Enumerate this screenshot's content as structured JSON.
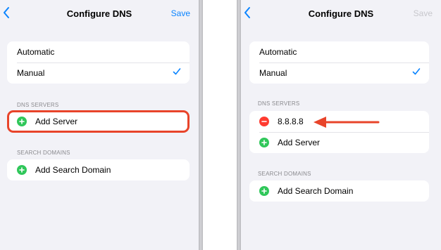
{
  "left_screen": {
    "nav": {
      "back_icon": "chevron-left-icon",
      "title": "Configure DNS",
      "save_label": "Save"
    },
    "mode_options": [
      {
        "label": "Automatic",
        "selected": false
      },
      {
        "label": "Manual",
        "selected": true
      }
    ],
    "dns_servers": {
      "header": "DNS SERVERS",
      "servers": [],
      "add_label": "Add Server"
    },
    "search_domains": {
      "header": "SEARCH DOMAINS",
      "add_label": "Add Search Domain"
    }
  },
  "right_screen": {
    "nav": {
      "back_icon": "chevron-left-icon",
      "title": "Configure DNS",
      "save_label": "Save",
      "save_enabled": false
    },
    "mode_options": [
      {
        "label": "Automatic",
        "selected": false
      },
      {
        "label": "Manual",
        "selected": true
      }
    ],
    "dns_servers": {
      "header": "DNS SERVERS",
      "servers": [
        {
          "address": "8.8.8.8"
        }
      ],
      "add_label": "Add Server"
    },
    "search_domains": {
      "header": "SEARCH DOMAINS",
      "add_label": "Add Search Domain"
    }
  },
  "annotations": {
    "highlight_color": "#e8442a",
    "arrow_color": "#e8442a"
  },
  "colors": {
    "accent": "#0a84ff",
    "add": "#30c75a",
    "remove": "#ff3b30",
    "background": "#f2f2f7"
  }
}
